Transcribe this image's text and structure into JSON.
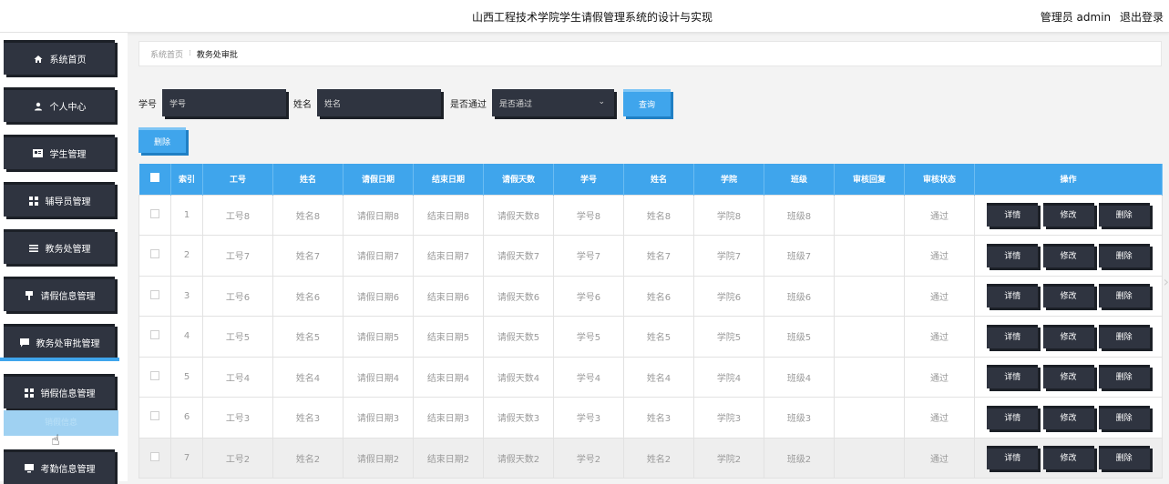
{
  "header": {
    "title": "山西工程技术学院学生请假管理系统的设计与实现",
    "user_label": "管理员 admin",
    "logout_label": "退出登录"
  },
  "sidebar": {
    "items": [
      {
        "label": "系统首页",
        "icon": "home-icon"
      },
      {
        "label": "个人中心",
        "icon": "user-icon"
      },
      {
        "label": "学生管理",
        "icon": "card-icon"
      },
      {
        "label": "辅导员管理",
        "icon": "grid-icon"
      },
      {
        "label": "教务处管理",
        "icon": "list-icon"
      },
      {
        "label": "请假信息管理",
        "icon": "pin-icon"
      },
      {
        "label": "教务处审批管理",
        "icon": "message-icon"
      },
      {
        "label": "销假信息管理",
        "icon": "grid-icon"
      },
      {
        "label": "考勤信息管理",
        "icon": "monitor-icon"
      }
    ],
    "submenu_label": "销假信息"
  },
  "breadcrumb": {
    "home": "系统首页",
    "current": "教务处审批"
  },
  "search": {
    "student_no_label": "学号",
    "student_no_placeholder": "学号",
    "name_label": "姓名",
    "name_placeholder": "姓名",
    "passed_label": "是否通过",
    "passed_value": "是否通过",
    "query_label": "查询"
  },
  "toolbar": {
    "delete_label": "删除"
  },
  "table": {
    "headers": [
      "索引",
      "工号",
      "姓名",
      "请假日期",
      "结束日期",
      "请假天数",
      "学号",
      "姓名",
      "学院",
      "班级",
      "审核回复",
      "审核状态",
      "操作"
    ],
    "rows": [
      {
        "index": "1",
        "work_no": "工号8",
        "name": "姓名8",
        "leave_date": "请假日期8",
        "end_date": "结束日期8",
        "days": "请假天数8",
        "student_no": "学号8",
        "student_name": "姓名8",
        "college": "学院8",
        "class": "班级8",
        "reply": "",
        "status": "通过"
      },
      {
        "index": "2",
        "work_no": "工号7",
        "name": "姓名7",
        "leave_date": "请假日期7",
        "end_date": "结束日期7",
        "days": "请假天数7",
        "student_no": "学号7",
        "student_name": "姓名7",
        "college": "学院7",
        "class": "班级7",
        "reply": "",
        "status": "通过"
      },
      {
        "index": "3",
        "work_no": "工号6",
        "name": "姓名6",
        "leave_date": "请假日期6",
        "end_date": "结束日期6",
        "days": "请假天数6",
        "student_no": "学号6",
        "student_name": "姓名6",
        "college": "学院6",
        "class": "班级6",
        "reply": "",
        "status": "通过"
      },
      {
        "index": "4",
        "work_no": "工号5",
        "name": "姓名5",
        "leave_date": "请假日期5",
        "end_date": "结束日期5",
        "days": "请假天数5",
        "student_no": "学号5",
        "student_name": "姓名5",
        "college": "学院5",
        "class": "班级5",
        "reply": "",
        "status": "通过"
      },
      {
        "index": "5",
        "work_no": "工号4",
        "name": "姓名4",
        "leave_date": "请假日期4",
        "end_date": "结束日期4",
        "days": "请假天数4",
        "student_no": "学号4",
        "student_name": "姓名4",
        "college": "学院4",
        "class": "班级4",
        "reply": "",
        "status": "通过"
      },
      {
        "index": "6",
        "work_no": "工号3",
        "name": "姓名3",
        "leave_date": "请假日期3",
        "end_date": "结束日期3",
        "days": "请假天数3",
        "student_no": "学号3",
        "student_name": "姓名3",
        "college": "学院3",
        "class": "班级3",
        "reply": "",
        "status": "通过"
      },
      {
        "index": "7",
        "work_no": "工号2",
        "name": "姓名2",
        "leave_date": "请假日期2",
        "end_date": "结束日期2",
        "days": "请假天数2",
        "student_no": "学号2",
        "student_name": "姓名2",
        "college": "学院2",
        "class": "班级2",
        "reply": "",
        "status": "通过"
      }
    ],
    "actions": {
      "detail": "详情",
      "edit": "修改",
      "delete": "删除"
    }
  },
  "colors": {
    "accent": "#3fa5ec",
    "dark": "#2f3440"
  }
}
